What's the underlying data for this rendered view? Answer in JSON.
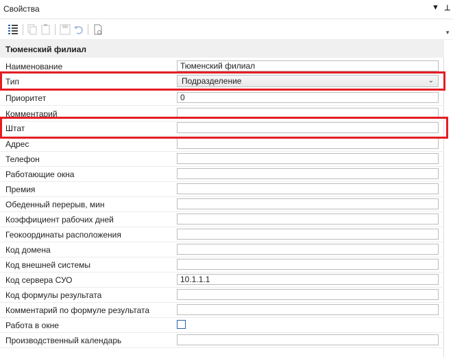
{
  "window": {
    "title": "Свойства",
    "dropdown_glyph": "▼",
    "pin_glyph": "⊥"
  },
  "toolbar": {
    "icons": [
      "list-view-icon",
      "copy-icon",
      "paste-icon",
      "save-icon",
      "undo-icon",
      "document-icon"
    ],
    "scroll_glyph": "▼"
  },
  "group": {
    "title": "Тюменский филиал"
  },
  "rows": [
    {
      "label": "Наименование",
      "value": "Тюменский филиал",
      "kind": "text"
    },
    {
      "label": "Тип",
      "value": "Подразделение",
      "kind": "select"
    },
    {
      "label": "Приоритет",
      "value": "0",
      "kind": "text"
    },
    {
      "label": "Комментарий",
      "value": "",
      "kind": "text"
    },
    {
      "label": "Штат",
      "value": "",
      "kind": "text"
    },
    {
      "label": "Адрес",
      "value": "",
      "kind": "text"
    },
    {
      "label": "Телефон",
      "value": "",
      "kind": "text"
    },
    {
      "label": "Работающие окна",
      "value": "",
      "kind": "text"
    },
    {
      "label": "Премия",
      "value": "",
      "kind": "text"
    },
    {
      "label": "Обеденный перерыв, мин",
      "value": "",
      "kind": "text"
    },
    {
      "label": "Коэффициент рабочих дней",
      "value": "",
      "kind": "text"
    },
    {
      "label": "Геокоординаты расположения",
      "value": "",
      "kind": "text"
    },
    {
      "label": "Код домена",
      "value": "",
      "kind": "text"
    },
    {
      "label": "Код внешней системы",
      "value": "",
      "kind": "text"
    },
    {
      "label": "Код сервера СУО",
      "value": "10.1.1.1",
      "kind": "text"
    },
    {
      "label": "Код формулы результата",
      "value": "",
      "kind": "text"
    },
    {
      "label": "Комментарий по формуле результата",
      "value": "",
      "kind": "text"
    },
    {
      "label": "Работа в окне",
      "value": "",
      "kind": "checkbox"
    },
    {
      "label": "Производственный календарь",
      "value": "",
      "kind": "text"
    }
  ],
  "select_chevron": "⌄",
  "highlight_color": "#e51c23"
}
